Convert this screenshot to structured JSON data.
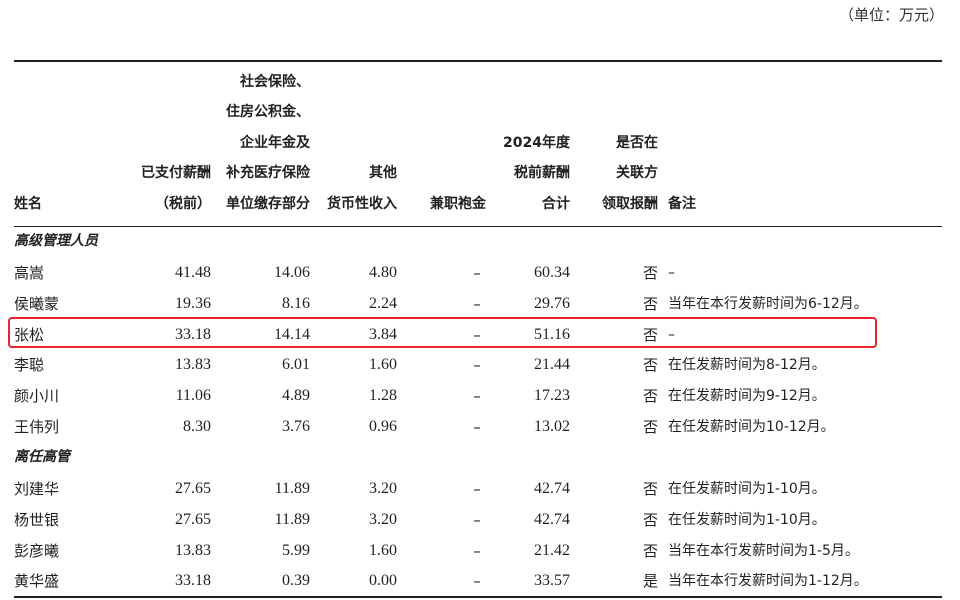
{
  "unit_note": "（单位：万元）",
  "headers": {
    "name": [
      "姓名"
    ],
    "paid": [
      "已支付薪酬",
      "（税前）"
    ],
    "social": [
      "社会保险、",
      "住房公积金、",
      "企业年金及",
      "补充医疗保险",
      "单位缴存部分"
    ],
    "other": [
      "其他",
      "货币性收入"
    ],
    "parttime": [
      "兼职袍金"
    ],
    "total": [
      "2024年度",
      "税前薪酬",
      "合计"
    ],
    "related": [
      "是否在",
      "关联方",
      "领取报酬"
    ],
    "remark": [
      "备注"
    ]
  },
  "sections": [
    {
      "title": "高级管理人员",
      "rows": [
        {
          "name": "高嵩",
          "paid": "41.48",
          "social": "14.06",
          "other": "4.80",
          "parttime": "–",
          "total": "60.34",
          "related": "否",
          "remark": "–"
        },
        {
          "name": "侯曦蒙",
          "paid": "19.36",
          "social": "8.16",
          "other": "2.24",
          "parttime": "–",
          "total": "29.76",
          "related": "否",
          "remark": "当年在本行发薪时间为6-12月。"
        },
        {
          "name": "张松",
          "paid": "33.18",
          "social": "14.14",
          "other": "3.84",
          "parttime": "–",
          "total": "51.16",
          "related": "否",
          "remark": "–"
        },
        {
          "name": "李聪",
          "paid": "13.83",
          "social": "6.01",
          "other": "1.60",
          "parttime": "–",
          "total": "21.44",
          "related": "否",
          "remark": "在任发薪时间为8-12月。"
        },
        {
          "name": "颜小川",
          "paid": "11.06",
          "social": "4.89",
          "other": "1.28",
          "parttime": "–",
          "total": "17.23",
          "related": "否",
          "remark": "在任发薪时间为9-12月。"
        },
        {
          "name": "王伟列",
          "paid": "8.30",
          "social": "3.76",
          "other": "0.96",
          "parttime": "–",
          "total": "13.02",
          "related": "否",
          "remark": "在任发薪时间为10-12月。"
        }
      ]
    },
    {
      "title": "离任高管",
      "rows": [
        {
          "name": "刘建华",
          "paid": "27.65",
          "social": "11.89",
          "other": "3.20",
          "parttime": "–",
          "total": "42.74",
          "related": "否",
          "remark": "在任发薪时间为1-10月。"
        },
        {
          "name": "杨世银",
          "paid": "27.65",
          "social": "11.89",
          "other": "3.20",
          "parttime": "–",
          "total": "42.74",
          "related": "否",
          "remark": "在任发薪时间为1-10月。"
        },
        {
          "name": "彭彦曦",
          "paid": "13.83",
          "social": "5.99",
          "other": "1.60",
          "parttime": "–",
          "total": "21.42",
          "related": "否",
          "remark": "当年在本行发薪时间为1-5月。"
        },
        {
          "name": "黄华盛",
          "paid": "33.18",
          "social": "0.39",
          "other": "0.00",
          "parttime": "–",
          "total": "33.57",
          "related": "是",
          "remark": "当年在本行发薪时间为1-12月。"
        }
      ]
    }
  ],
  "colors": {
    "text": "#231f20",
    "highlight_border": "#e8242a"
  }
}
